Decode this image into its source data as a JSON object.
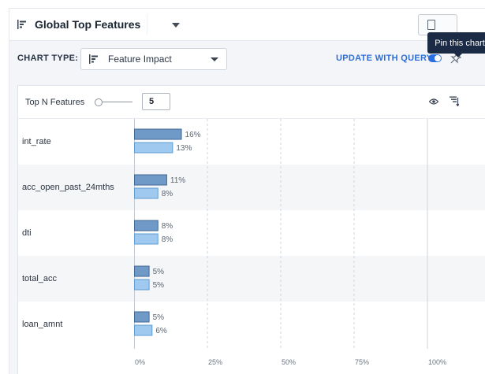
{
  "header": {
    "title": "Global Top Features",
    "tooltip": "Pin this chart"
  },
  "chart_type": {
    "label": "CHART TYPE:",
    "value": "Feature Impact",
    "update_label": "UPDATE WITH QUERY",
    "update_enabled": true
  },
  "controls": {
    "top_n_label": "Top N Features",
    "top_n_value": "5"
  },
  "colors": {
    "series1": "#6f99c6",
    "series1_border": "#3f6896",
    "series2": "#9fc9ee",
    "series2_border": "#5f9cd2",
    "grid": "#cfd4da"
  },
  "chart_data": {
    "type": "bar",
    "orientation": "horizontal",
    "categories": [
      "int_rate",
      "acc_open_past_24mths",
      "dti",
      "total_acc",
      "loan_amnt"
    ],
    "series": [
      {
        "values": [
          16,
          11,
          8,
          5,
          5
        ],
        "labels": [
          "16%",
          "11%",
          "8%",
          "5%",
          "5%"
        ]
      },
      {
        "values": [
          13,
          8,
          8,
          5,
          6
        ],
        "labels": [
          "13%",
          "8%",
          "8%",
          "5%",
          "6%"
        ]
      }
    ],
    "xlim": [
      0,
      100
    ],
    "x_ticks": [
      "0%",
      "25%",
      "50%",
      "75%",
      "100%"
    ],
    "grid": true
  }
}
